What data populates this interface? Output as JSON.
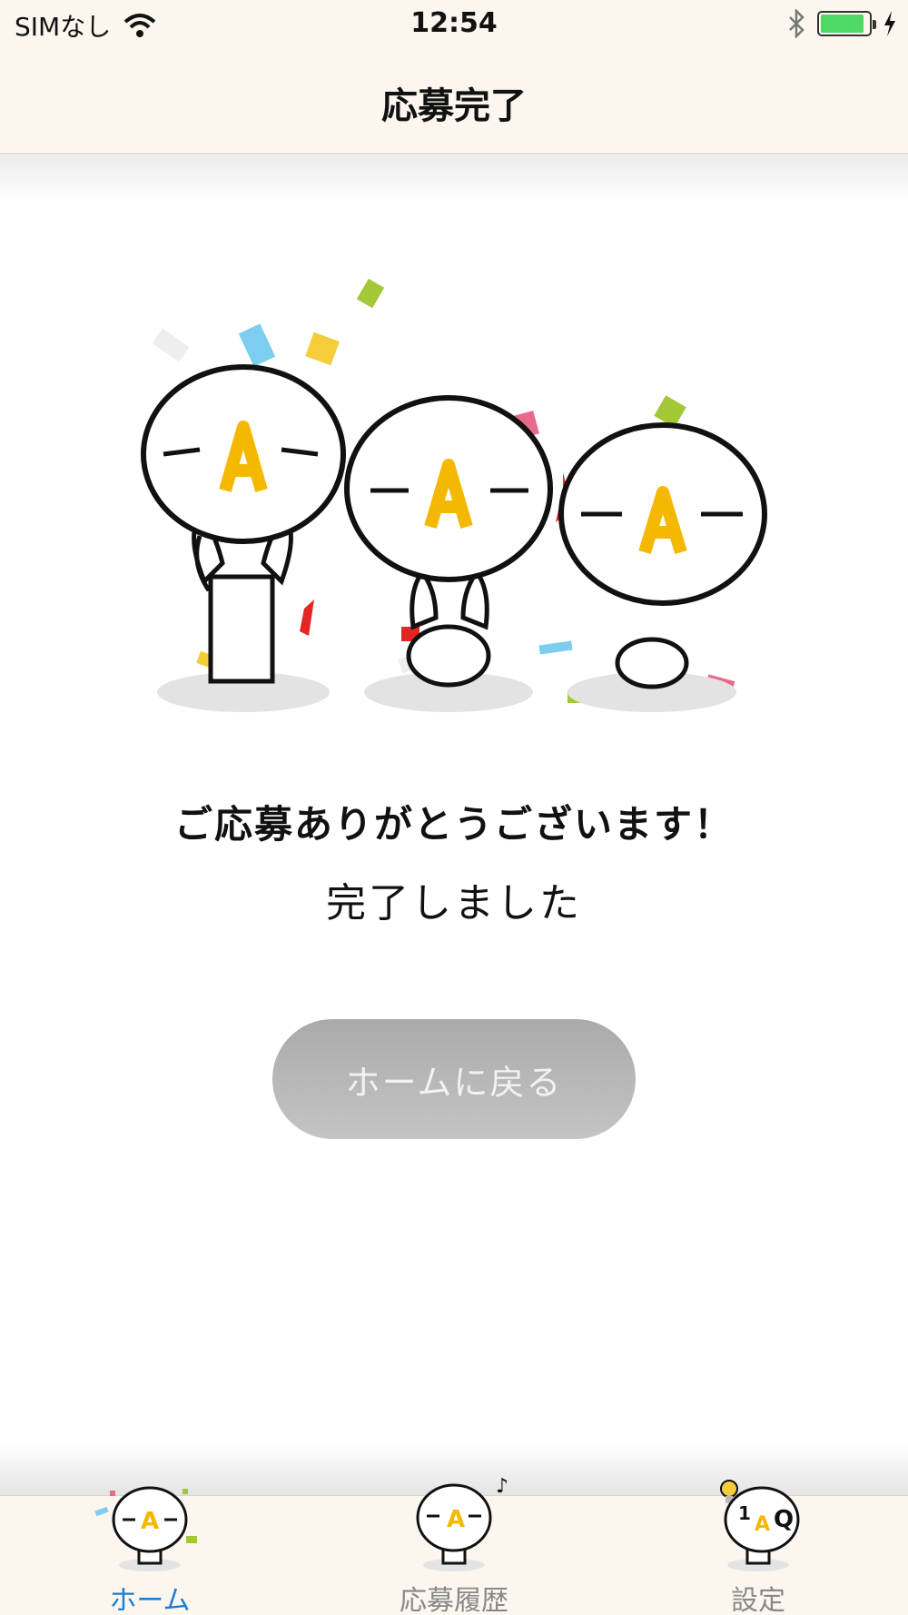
{
  "status_bar": {
    "carrier": "SIMなし",
    "time": "12:54",
    "battery_level": 0.9,
    "icons": [
      "wifi-icon",
      "bluetooth-icon",
      "battery-icon",
      "charging-icon"
    ]
  },
  "nav": {
    "title": "応募完了"
  },
  "illustration": {
    "badge_letter": "A"
  },
  "main": {
    "thanks": "ご応募ありがとうございます！",
    "done": "完了しました",
    "home_button": "ホームに戻る"
  },
  "tabs": [
    {
      "label": "ホーム",
      "active": true,
      "icon": "home-mascot-icon",
      "badge": "A"
    },
    {
      "label": "応募履歴",
      "active": false,
      "icon": "history-mascot-icon",
      "badge": "A"
    },
    {
      "label": "設定",
      "active": false,
      "icon": "settings-mascot-icon",
      "badge": "Q"
    }
  ],
  "colors": {
    "accent": "#1a7fd4",
    "badge": "#f5b800",
    "bar_background": "#fcf6ef",
    "button": "#b5b5b5"
  }
}
